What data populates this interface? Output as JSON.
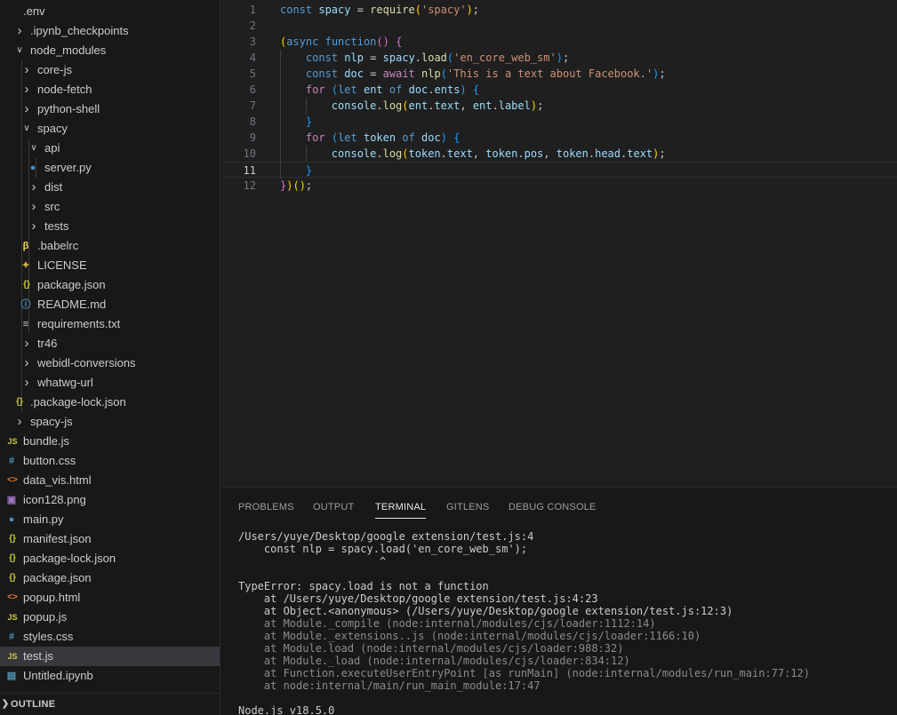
{
  "sidebar": {
    "items": [
      {
        "label": ".env",
        "depth": 0,
        "kind": "file",
        "icon": "gear-icon",
        "glyph": "",
        "color": "#cccccc"
      },
      {
        "label": ".ipynb_checkpoints",
        "depth": 0,
        "kind": "folder-closed"
      },
      {
        "label": "node_modules",
        "depth": 0,
        "kind": "folder-open"
      },
      {
        "label": "core-js",
        "depth": 1,
        "kind": "folder-closed"
      },
      {
        "label": "node-fetch",
        "depth": 1,
        "kind": "folder-closed"
      },
      {
        "label": "python-shell",
        "depth": 1,
        "kind": "folder-closed"
      },
      {
        "label": "spacy",
        "depth": 1,
        "kind": "folder-open"
      },
      {
        "label": "api",
        "depth": 2,
        "kind": "folder-open"
      },
      {
        "label": "server.py",
        "depth": 3,
        "kind": "file",
        "icon": "python-icon",
        "glyph": "●",
        "color": "#4b8bbe"
      },
      {
        "label": "dist",
        "depth": 2,
        "kind": "folder-closed"
      },
      {
        "label": "src",
        "depth": 2,
        "kind": "folder-closed"
      },
      {
        "label": "tests",
        "depth": 2,
        "kind": "folder-closed"
      },
      {
        "label": ".babelrc",
        "depth": 2,
        "kind": "file",
        "icon": "babel-icon",
        "glyph": "β",
        "color": "#f5da55"
      },
      {
        "label": "LICENSE",
        "depth": 2,
        "kind": "file",
        "icon": "license-icon",
        "glyph": "✦",
        "color": "#d4b44a"
      },
      {
        "label": "package.json",
        "depth": 2,
        "kind": "file",
        "icon": "json-icon",
        "glyph": "{}",
        "color": "#cbcb41"
      },
      {
        "label": "README.md",
        "depth": 2,
        "kind": "file",
        "icon": "info-icon",
        "glyph": "ⓘ",
        "color": "#519aba"
      },
      {
        "label": "requirements.txt",
        "depth": 2,
        "kind": "file",
        "icon": "text-icon",
        "glyph": "≡",
        "color": "#cccccc"
      },
      {
        "label": "tr46",
        "depth": 1,
        "kind": "folder-closed"
      },
      {
        "label": "webidl-conversions",
        "depth": 1,
        "kind": "folder-closed"
      },
      {
        "label": "whatwg-url",
        "depth": 1,
        "kind": "folder-closed"
      },
      {
        "label": ".package-lock.json",
        "depth": 1,
        "kind": "file",
        "icon": "json-icon",
        "glyph": "{}",
        "color": "#cbcb41"
      },
      {
        "label": "spacy-js",
        "depth": 0,
        "kind": "folder-closed"
      },
      {
        "label": "bundle.js",
        "depth": 0,
        "kind": "file",
        "icon": "js-icon",
        "glyph": "JS",
        "color": "#cbcb41"
      },
      {
        "label": "button.css",
        "depth": 0,
        "kind": "file",
        "icon": "css-icon",
        "glyph": "#",
        "color": "#519aba"
      },
      {
        "label": "data_vis.html",
        "depth": 0,
        "kind": "file",
        "icon": "html-icon",
        "glyph": "<>",
        "color": "#e37933"
      },
      {
        "label": "icon128.png",
        "depth": 0,
        "kind": "file",
        "icon": "image-icon",
        "glyph": "▣",
        "color": "#a074c4"
      },
      {
        "label": "main.py",
        "depth": 0,
        "kind": "file",
        "icon": "python-icon",
        "glyph": "●",
        "color": "#4b8bbe"
      },
      {
        "label": "manifest.json",
        "depth": 0,
        "kind": "file",
        "icon": "json-icon",
        "glyph": "{}",
        "color": "#cbcb41"
      },
      {
        "label": "package-lock.json",
        "depth": 0,
        "kind": "file",
        "icon": "json-icon",
        "glyph": "{}",
        "color": "#cbcb41"
      },
      {
        "label": "package.json",
        "depth": 0,
        "kind": "file",
        "icon": "json-icon",
        "glyph": "{}",
        "color": "#cbcb41"
      },
      {
        "label": "popup.html",
        "depth": 0,
        "kind": "file",
        "icon": "html-icon",
        "glyph": "<>",
        "color": "#e37933"
      },
      {
        "label": "popup.js",
        "depth": 0,
        "kind": "file",
        "icon": "js-icon",
        "glyph": "JS",
        "color": "#cbcb41"
      },
      {
        "label": "styles.css",
        "depth": 0,
        "kind": "file",
        "icon": "css-icon",
        "glyph": "#",
        "color": "#519aba"
      },
      {
        "label": "test.js",
        "depth": 0,
        "kind": "file",
        "icon": "js-icon",
        "glyph": "JS",
        "color": "#cbcb41",
        "selected": true
      },
      {
        "label": "Untitled.ipynb",
        "depth": 0,
        "kind": "file",
        "icon": "notebook-icon",
        "glyph": "▤",
        "color": "#519aba"
      }
    ],
    "outline_label": "OUTLINE"
  },
  "editor": {
    "current_line": 11,
    "lines": [
      [
        [
          "k",
          "const"
        ],
        [
          "t",
          " "
        ],
        [
          "v",
          "spacy"
        ],
        [
          "t",
          " = "
        ],
        [
          "f",
          "require"
        ],
        [
          "p",
          "("
        ],
        [
          "s",
          "'spacy'"
        ],
        [
          "p",
          ")"
        ],
        [
          "t",
          ";"
        ]
      ],
      [],
      [
        [
          "p",
          "("
        ],
        [
          "k",
          "async"
        ],
        [
          "t",
          " "
        ],
        [
          "k",
          "function"
        ],
        [
          "p2",
          "()"
        ],
        [
          "t",
          " "
        ],
        [
          "p2",
          "{"
        ]
      ],
      [
        [
          "t",
          "    "
        ],
        [
          "k",
          "const"
        ],
        [
          "t",
          " "
        ],
        [
          "v",
          "nlp"
        ],
        [
          "t",
          " = "
        ],
        [
          "v",
          "spacy"
        ],
        [
          "t",
          "."
        ],
        [
          "f",
          "load"
        ],
        [
          "p3",
          "("
        ],
        [
          "s",
          "'en_core_web_sm'"
        ],
        [
          "p3",
          ")"
        ],
        [
          "t",
          ";"
        ]
      ],
      [
        [
          "t",
          "    "
        ],
        [
          "k",
          "const"
        ],
        [
          "t",
          " "
        ],
        [
          "v",
          "doc"
        ],
        [
          "t",
          " = "
        ],
        [
          "kc",
          "await"
        ],
        [
          "t",
          " "
        ],
        [
          "f",
          "nlp"
        ],
        [
          "p3",
          "("
        ],
        [
          "s",
          "'This is a text about Facebook.'"
        ],
        [
          "p3",
          ")"
        ],
        [
          "t",
          ";"
        ]
      ],
      [
        [
          "t",
          "    "
        ],
        [
          "kc",
          "for"
        ],
        [
          "t",
          " "
        ],
        [
          "p3",
          "("
        ],
        [
          "k",
          "let"
        ],
        [
          "t",
          " "
        ],
        [
          "v",
          "ent"
        ],
        [
          "t",
          " "
        ],
        [
          "k",
          "of"
        ],
        [
          "t",
          " "
        ],
        [
          "v",
          "doc"
        ],
        [
          "t",
          "."
        ],
        [
          "v",
          "ents"
        ],
        [
          "p3",
          ")"
        ],
        [
          "t",
          " "
        ],
        [
          "p3",
          "{"
        ]
      ],
      [
        [
          "t",
          "        "
        ],
        [
          "v",
          "console"
        ],
        [
          "t",
          "."
        ],
        [
          "f",
          "log"
        ],
        [
          "p",
          "("
        ],
        [
          "v",
          "ent"
        ],
        [
          "t",
          "."
        ],
        [
          "v",
          "text"
        ],
        [
          "t",
          ", "
        ],
        [
          "v",
          "ent"
        ],
        [
          "t",
          "."
        ],
        [
          "v",
          "label"
        ],
        [
          "p",
          ")"
        ],
        [
          "t",
          ";"
        ]
      ],
      [
        [
          "t",
          "    "
        ],
        [
          "p3",
          "}"
        ]
      ],
      [
        [
          "t",
          "    "
        ],
        [
          "kc",
          "for"
        ],
        [
          "t",
          " "
        ],
        [
          "p3",
          "("
        ],
        [
          "k",
          "let"
        ],
        [
          "t",
          " "
        ],
        [
          "v",
          "token"
        ],
        [
          "t",
          " "
        ],
        [
          "k",
          "of"
        ],
        [
          "t",
          " "
        ],
        [
          "v",
          "doc"
        ],
        [
          "p3",
          ")"
        ],
        [
          "t",
          " "
        ],
        [
          "p3",
          "{"
        ]
      ],
      [
        [
          "t",
          "        "
        ],
        [
          "v",
          "console"
        ],
        [
          "t",
          "."
        ],
        [
          "f",
          "log"
        ],
        [
          "p",
          "("
        ],
        [
          "v",
          "token"
        ],
        [
          "t",
          "."
        ],
        [
          "v",
          "text"
        ],
        [
          "t",
          ", "
        ],
        [
          "v",
          "token"
        ],
        [
          "t",
          "."
        ],
        [
          "v",
          "pos"
        ],
        [
          "t",
          ", "
        ],
        [
          "v",
          "token"
        ],
        [
          "t",
          "."
        ],
        [
          "v",
          "head"
        ],
        [
          "t",
          "."
        ],
        [
          "v",
          "text"
        ],
        [
          "p",
          ")"
        ],
        [
          "t",
          ";"
        ]
      ],
      [
        [
          "t",
          "    "
        ],
        [
          "p3",
          "}"
        ]
      ],
      [
        [
          "p2",
          "}"
        ],
        [
          "p",
          ")"
        ],
        [
          "p",
          "()"
        ],
        [
          "t",
          ";"
        ]
      ]
    ]
  },
  "panel": {
    "tabs": [
      {
        "label": "PROBLEMS",
        "active": false
      },
      {
        "label": "OUTPUT",
        "active": false
      },
      {
        "label": "TERMINAL",
        "active": true
      },
      {
        "label": "GITLENS",
        "active": false
      },
      {
        "label": "DEBUG CONSOLE",
        "active": false
      }
    ],
    "terminal_lines": [
      {
        "text": "/Users/yuye/Desktop/google extension/test.js:4",
        "dim": false
      },
      {
        "text": "    const nlp = spacy.load('en_core_web_sm');",
        "dim": false
      },
      {
        "text": "                      ^",
        "dim": false
      },
      {
        "text": "",
        "dim": false
      },
      {
        "text": "TypeError: spacy.load is not a function",
        "dim": false
      },
      {
        "text": "    at /Users/yuye/Desktop/google extension/test.js:4:23",
        "dim": false
      },
      {
        "text": "    at Object.<anonymous> (/Users/yuye/Desktop/google extension/test.js:12:3)",
        "dim": false
      },
      {
        "text": "    at Module._compile (node:internal/modules/cjs/loader:1112:14)",
        "dim": true
      },
      {
        "text": "    at Module._extensions..js (node:internal/modules/cjs/loader:1166:10)",
        "dim": true
      },
      {
        "text": "    at Module.load (node:internal/modules/cjs/loader:988:32)",
        "dim": true
      },
      {
        "text": "    at Module._load (node:internal/modules/cjs/loader:834:12)",
        "dim": true
      },
      {
        "text": "    at Function.executeUserEntryPoint [as runMain] (node:internal/modules/run_main:77:12)",
        "dim": true
      },
      {
        "text": "    at node:internal/main/run_main_module:17:47",
        "dim": true
      },
      {
        "text": "",
        "dim": false
      },
      {
        "text": "Node.js v18.5.0",
        "dim": false
      }
    ]
  }
}
